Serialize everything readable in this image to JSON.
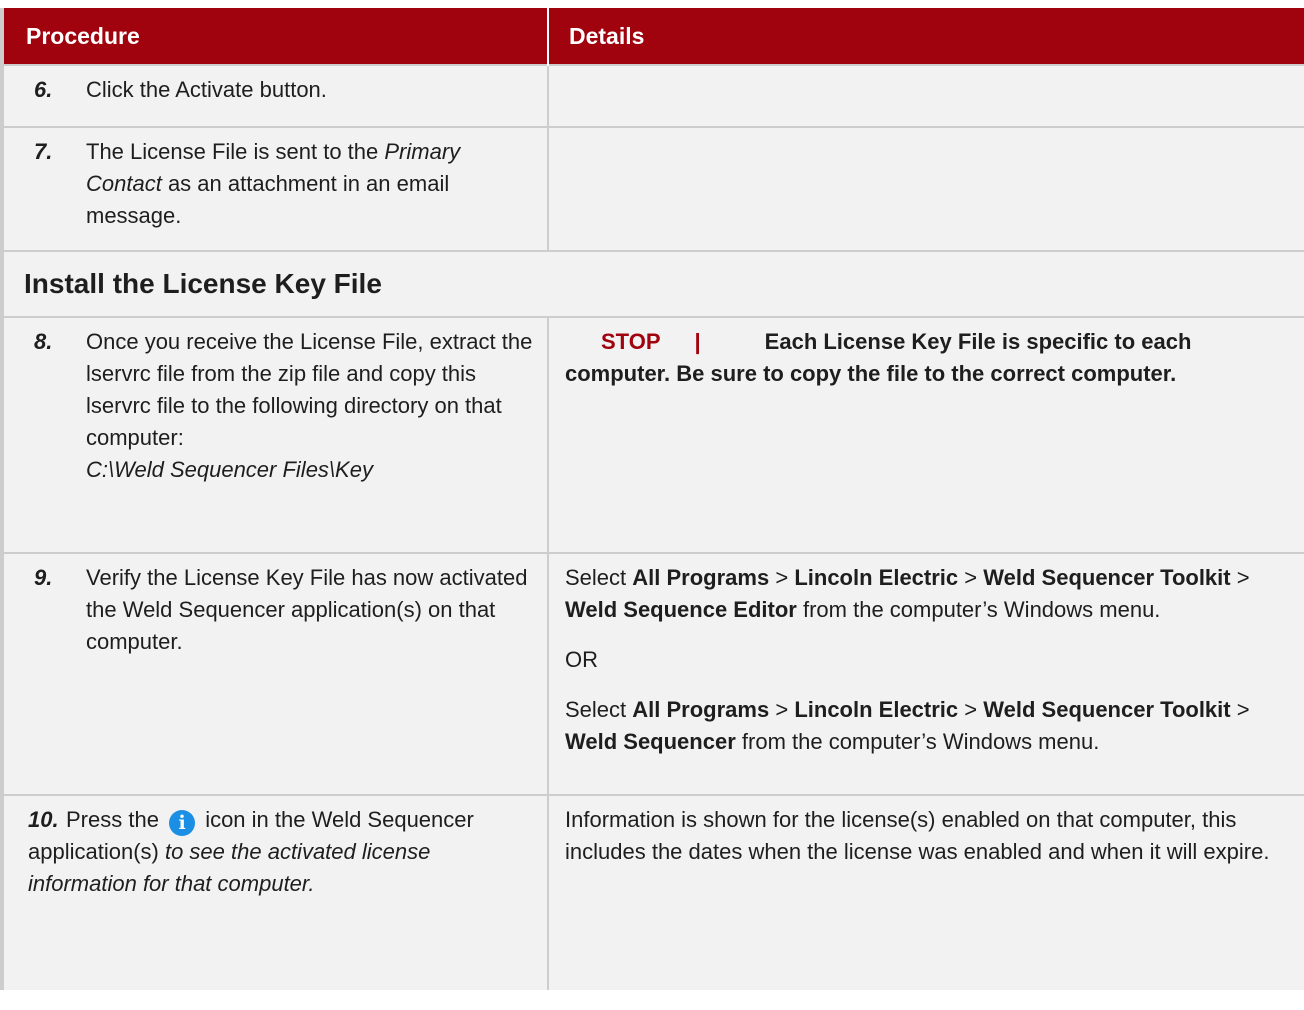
{
  "header": {
    "procedure": "Procedure",
    "details": "Details"
  },
  "step6": {
    "num": "6.",
    "text": "Click the Activate button."
  },
  "step7": {
    "num": "7.",
    "text_a": "The License File is sent to the ",
    "text_italic": "Primary Contact",
    "text_b": " as an attachment in an email message."
  },
  "section_title": "Install the License Key File",
  "step8": {
    "num": "8.",
    "text": "Once you receive the License File, extract the lservrc file from the zip file and copy this lservrc file to the following directory on that computer:",
    "path": "C:\\Weld Sequencer Files\\Key",
    "stop_label": "STOP",
    "stop_bar": "|",
    "stop_text_1": "Each License Key File is specific to each",
    "stop_text_2": "computer.  Be sure to copy the file to the correct computer."
  },
  "step9": {
    "num": "9.",
    "text": "Verify the License Key File has now activated the Weld Sequencer application(s) on that computer.",
    "select": "Select",
    "all_programs": "All Programs",
    "sep": ">",
    "lincoln": "Lincoln Electric",
    "toolkit": "Weld Sequencer Toolkit",
    "editor": "Weld Sequence Editor",
    "editor_tail": "from the computer’s Windows menu.",
    "or": "OR",
    "sequencer": "Weld Sequencer",
    "sequencer_tail": "from the computer’s Windows menu."
  },
  "step10": {
    "num": "10.",
    "text_a": "Press the",
    "icon_glyph": "i",
    "text_b": "icon in the Weld Sequencer application(s)",
    "text_italic": "to see the activated license information for that computer.",
    "details": "Information is shown for the license(s) enabled on that computer, this includes the dates when the license was enabled and when it will expire."
  },
  "colors": {
    "accent": "#a1030e",
    "row_bg": "#f2f2f2",
    "icon": "#1a8fe3"
  }
}
